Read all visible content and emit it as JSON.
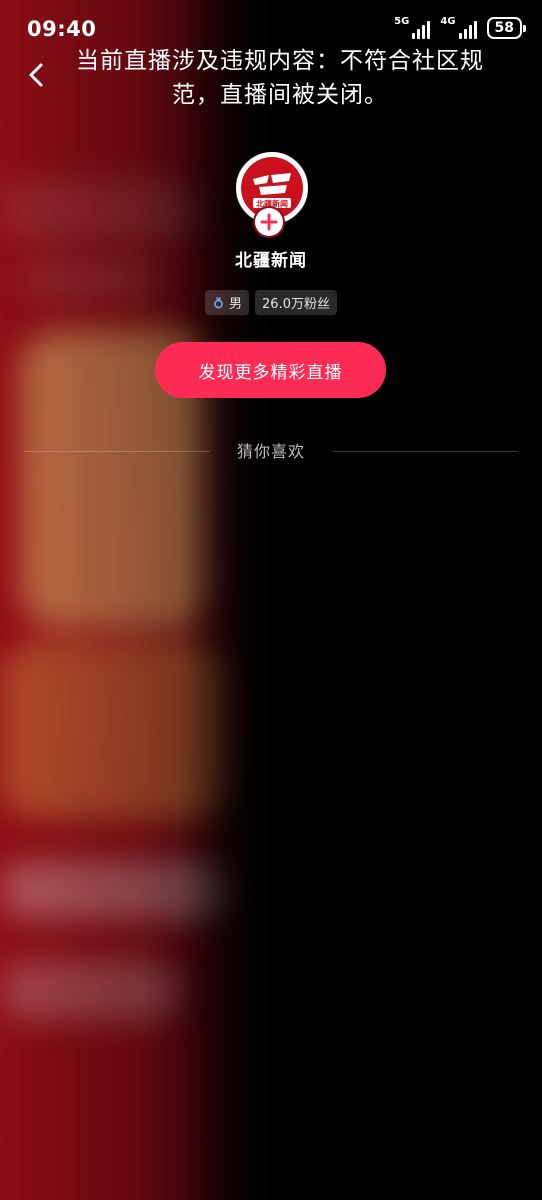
{
  "status_bar": {
    "time": "09:40",
    "network_1": "5G",
    "network_2": "4G",
    "battery": "58"
  },
  "header": {
    "notice": "当前直播涉及违规内容：不符合社区规范，直播间被关闭。"
  },
  "profile": {
    "name": "北疆新闻",
    "gender_tag": "男",
    "followers_tag": "26.0万粉丝",
    "avatar_logo_text": "北疆新闻"
  },
  "actions": {
    "discover_label": "发现更多精彩直播"
  },
  "recommend": {
    "section_label": "猜你喜欢"
  },
  "colors": {
    "accent": "#fe2c55",
    "logo_red": "#c8101e",
    "background": "#000000"
  },
  "icons": {
    "back": "chevron-left-icon",
    "follow": "plus-icon",
    "gender": "male-icon"
  }
}
